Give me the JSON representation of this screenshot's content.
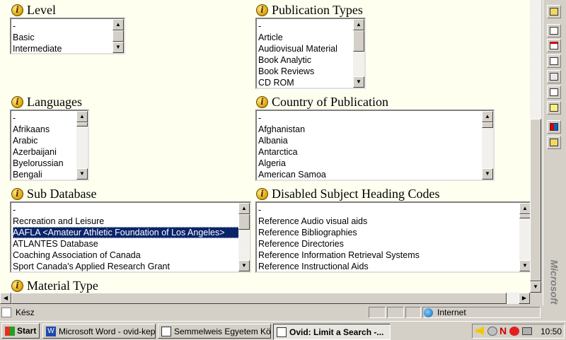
{
  "sections": {
    "level": {
      "title": "Level",
      "options": [
        "-",
        "Basic",
        "Intermediate"
      ],
      "selected": -1
    },
    "publication_types": {
      "title": "Publication Types",
      "options": [
        "-",
        "Article",
        "Audiovisual Material",
        "Book Analytic",
        "Book Reviews",
        "CD ROM"
      ],
      "selected": -1
    },
    "languages": {
      "title": "Languages",
      "options": [
        "-",
        "Afrikaans",
        "Arabic",
        "Azerbaijani",
        "Byelorussian",
        "Bengali"
      ],
      "selected": -1
    },
    "country": {
      "title": "Country of Publication",
      "options": [
        "-",
        "Afghanistan",
        "Albania",
        "Antarctica",
        "Algeria",
        "American Samoa"
      ],
      "selected": -1
    },
    "sub_database": {
      "title": "Sub Database",
      "options": [
        "-",
        "Recreation and Leisure",
        "AAFLA <Amateur Athletic Foundation of Los Angeles>",
        "ATLANTES Database",
        "Coaching Association of Canada",
        "Sport Canada's Applied Research Grant"
      ],
      "selected": 2
    },
    "disabled_codes": {
      "title": "Disabled Subject Heading Codes",
      "options": [
        "-",
        "Reference Audio visual aids",
        "Reference Bibliographies",
        "Reference Directories",
        "Reference Information Retrieval Systems",
        "Reference Instructional Aids"
      ],
      "selected": -1
    },
    "material_type": {
      "title": "Material Type"
    }
  },
  "brand_text": "Microsoft",
  "status": {
    "text": "Kész",
    "zone": "Internet"
  },
  "taskbar": {
    "start": "Start",
    "tasks": [
      {
        "label": "Microsoft Word - ovid-kep...",
        "active": false
      },
      {
        "label": "Semmelweis Egyetem Köz...",
        "active": false
      },
      {
        "label": "Ovid: Limit a Search -...",
        "active": true
      }
    ],
    "clock": "10:50"
  },
  "colors": {
    "page_bg": "#fffff0",
    "selection": "#0a246a",
    "chrome": "#d4d0c8"
  }
}
